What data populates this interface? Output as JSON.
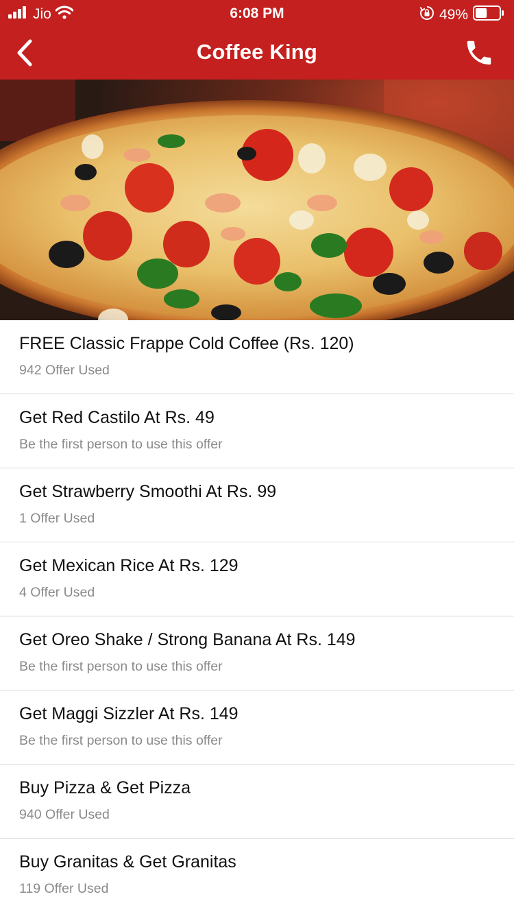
{
  "status_bar": {
    "carrier": "Jio",
    "time": "6:08 PM",
    "battery": "49%",
    "battery_level": 0.49
  },
  "header": {
    "title": "Coffee King",
    "back_icon": "chevron-left-icon",
    "call_icon": "phone-icon"
  },
  "colors": {
    "header_bg": "#c4201f",
    "title_text": "#111111",
    "subtitle_text": "#8a8a8a",
    "divider": "#d8d8d8"
  },
  "hero": {
    "image": "pizza-banner"
  },
  "offers": [
    {
      "title": "FREE Classic Frappe Cold Coffee (Rs. 120)",
      "subtitle": "942 Offer Used"
    },
    {
      "title": "Get Red Castilo At Rs. 49",
      "subtitle": "Be the first person to use this offer"
    },
    {
      "title": "Get Strawberry Smoothi At Rs. 99",
      "subtitle": "1 Offer Used"
    },
    {
      "title": "Get Mexican Rice At Rs. 129",
      "subtitle": "4 Offer Used"
    },
    {
      "title": "Get Oreo Shake / Strong Banana At Rs. 149",
      "subtitle": "Be the first person to use this offer"
    },
    {
      "title": "Get Maggi Sizzler At Rs. 149",
      "subtitle": "Be the first person to use this offer"
    },
    {
      "title": "Buy Pizza & Get Pizza",
      "subtitle": "940 Offer Used"
    },
    {
      "title": "Buy Granitas & Get Granitas",
      "subtitle": "119 Offer Used"
    }
  ]
}
